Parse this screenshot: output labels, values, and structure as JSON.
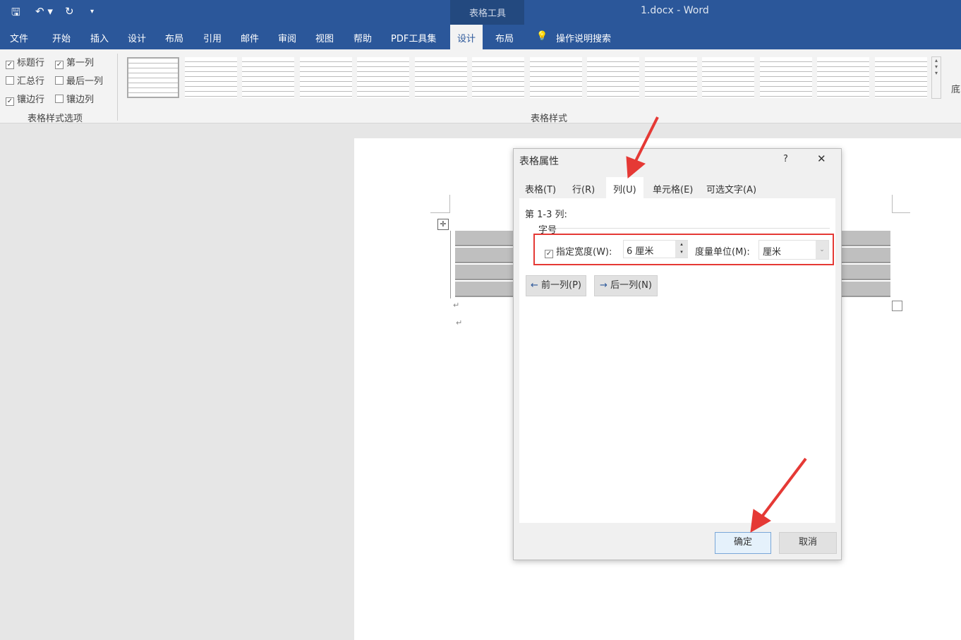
{
  "window": {
    "title": "1.docx  -  Word",
    "context_tab_group": "表格工具"
  },
  "quick_access": {
    "save_icon": "save-icon",
    "undo_icon": "undo-icon",
    "redo_icon": "redo-icon",
    "customize_icon": "customize-icon"
  },
  "ribbon_tabs": [
    "文件",
    "开始",
    "插入",
    "设计",
    "布局",
    "引用",
    "邮件",
    "审阅",
    "视图",
    "帮助",
    "PDF工具集",
    "设计",
    "布局"
  ],
  "active_tab": "设计",
  "tell_me": "操作说明搜索",
  "style_options": {
    "group_label": "表格样式选项",
    "items": [
      {
        "label": "标题行",
        "checked": true
      },
      {
        "label": "第一列",
        "checked": true
      },
      {
        "label": "汇总行",
        "checked": false
      },
      {
        "label": "最后一列",
        "checked": false
      },
      {
        "label": "镶边行",
        "checked": true
      },
      {
        "label": "镶边列",
        "checked": false
      }
    ]
  },
  "table_styles": {
    "group_label": "表格样式",
    "shading_label": "底"
  },
  "dialog": {
    "title": "表格属性",
    "help": "?",
    "close": "✕",
    "tabs": [
      "表格(T)",
      "行(R)",
      "列(U)",
      "单元格(E)",
      "可选文字(A)"
    ],
    "active_tab": "列(U)",
    "section_label": "第 1-3 列:",
    "size_label": "字号",
    "width_checkbox": {
      "label": "指定宽度(W):",
      "checked": true
    },
    "width_value": "6 厘米",
    "unit_label": "度量单位(M):",
    "unit_value": "厘米",
    "prev_button": "前一列(P)",
    "next_button": "后一列(N)",
    "ok": "确定",
    "cancel": "取消"
  },
  "colors": {
    "title_bar": "#2b579a",
    "highlight": "#e53935"
  }
}
